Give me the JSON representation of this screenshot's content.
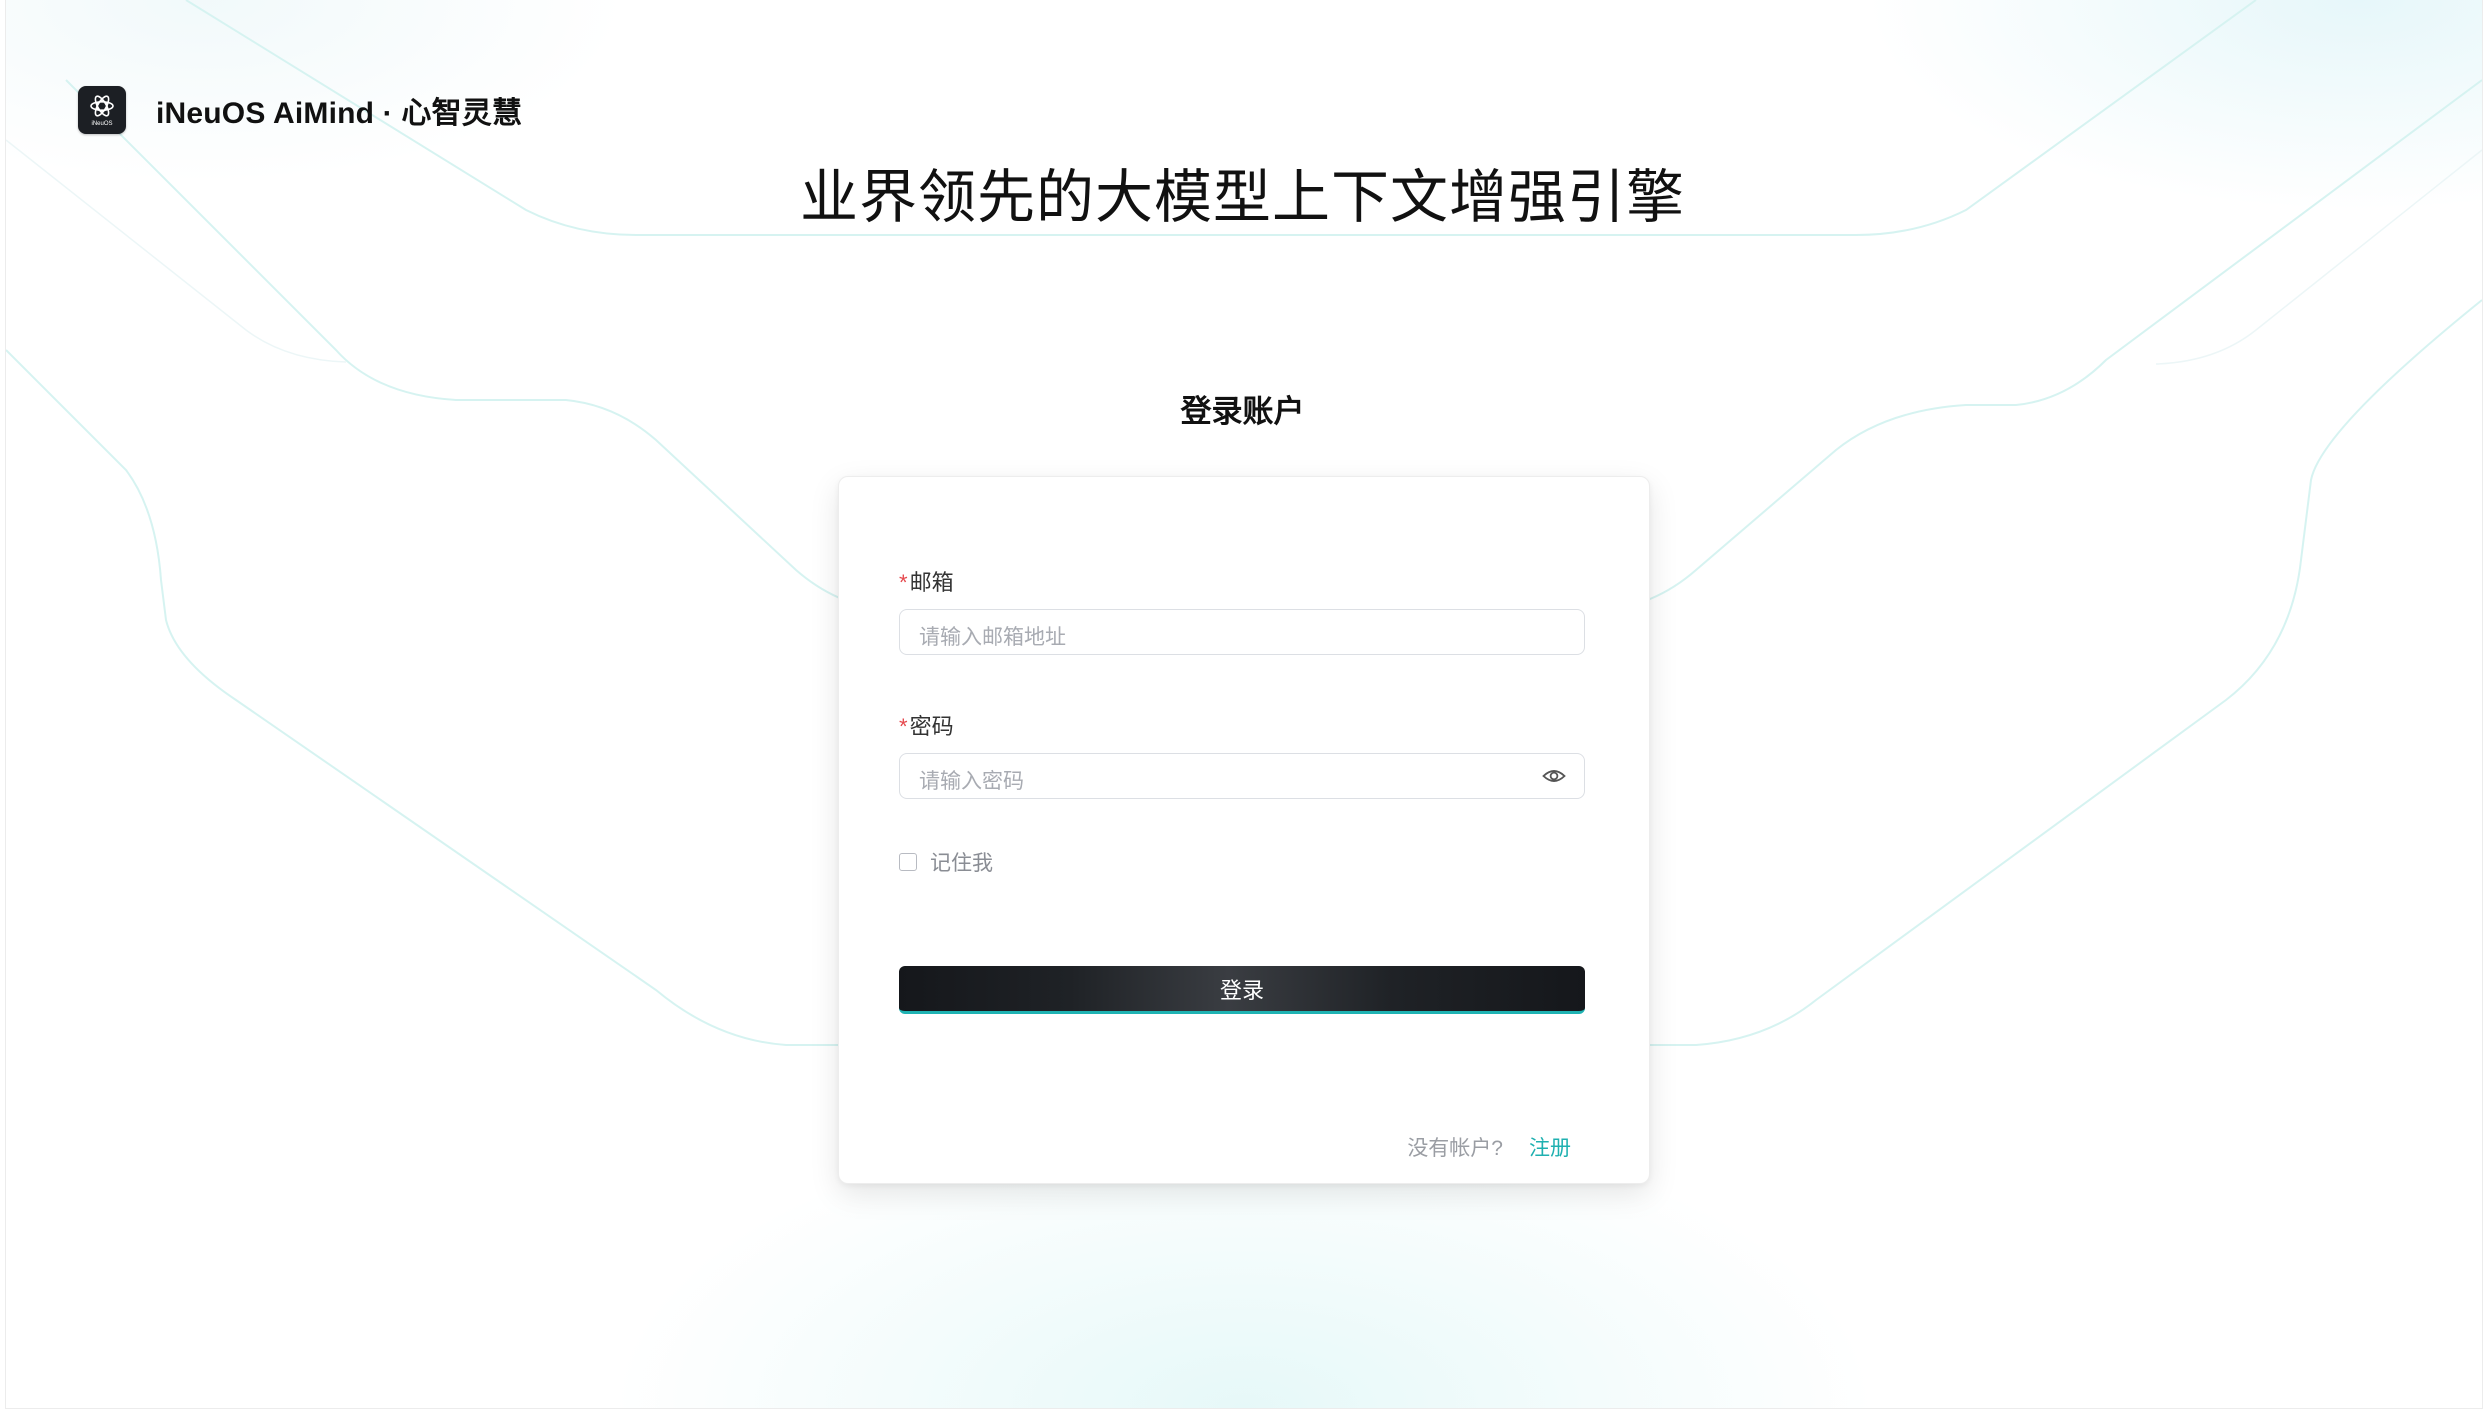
{
  "brand": {
    "logo_icon": "atom-gear-logo-icon",
    "logo_small_text": "iNeuOS",
    "name": "iNeuOS AiMind · 心智灵慧"
  },
  "hero": {
    "title": "业界领先的大模型上下文增强引擎"
  },
  "login": {
    "heading": "登录账户",
    "email": {
      "required_mark": "*",
      "label": "邮箱",
      "placeholder": "请输入邮箱地址",
      "value": ""
    },
    "password": {
      "required_mark": "*",
      "label": "密码",
      "placeholder": "请输入密码",
      "value": "",
      "toggle_icon": "eye-icon"
    },
    "remember": {
      "label": "记住我",
      "checked": false
    },
    "submit_label": "登录",
    "signup_hint": "没有帐户?",
    "signup_link": "注册"
  },
  "colors": {
    "accent": "#1fb0b0",
    "button_dark": "#15171b",
    "required": "#e5484d"
  }
}
